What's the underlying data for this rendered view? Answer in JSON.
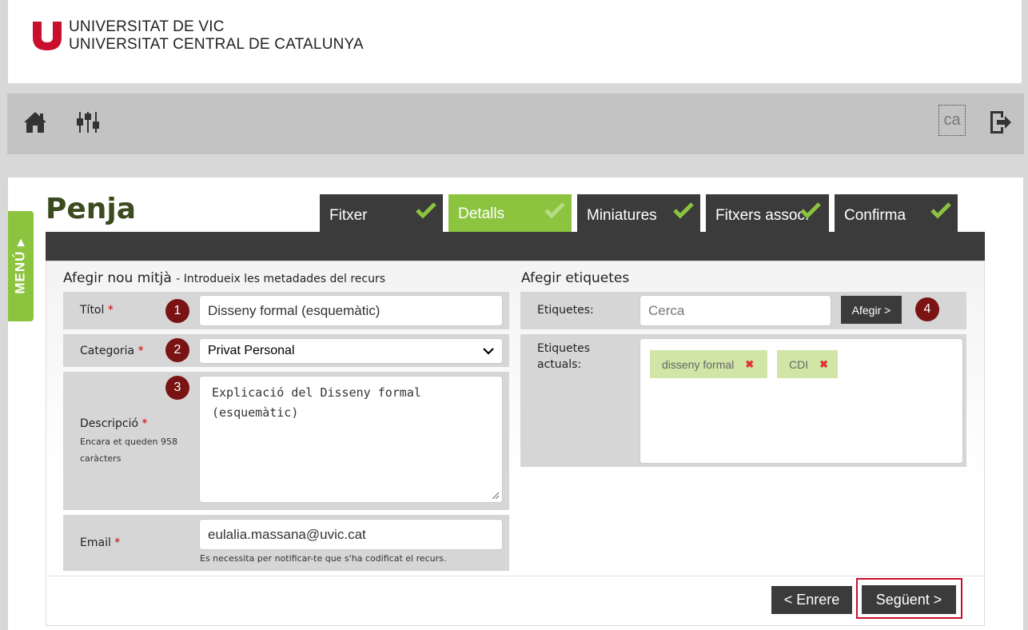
{
  "header": {
    "university_line1": "UNIVERSITAT DE VIC",
    "university_line2": "UNIVERSITAT CENTRAL DE CATALUNYA",
    "brand_color": "#c8102e"
  },
  "toolbar": {
    "icons": [
      "home-icon",
      "settings-sliders-icon",
      "logout-icon"
    ],
    "language": "ca"
  },
  "side_menu": {
    "label": "MENÚ ▸"
  },
  "page": {
    "title": "Penja"
  },
  "tabs": [
    {
      "label": "Fitxer",
      "active": false,
      "done": true
    },
    {
      "label": "Detalls",
      "active": true,
      "done": true
    },
    {
      "label": "Miniatures",
      "active": false,
      "done": true
    },
    {
      "label": "Fitxers assoc.",
      "active": false,
      "done": true
    },
    {
      "label": "Confirma",
      "active": false,
      "done": true
    }
  ],
  "form": {
    "heading": "Afegir nou mitjà",
    "subheading": "- Introdueix les metadades del recurs",
    "title_label": "Títol",
    "title_value": "Disseny formal (esquemàtic)",
    "category_label": "Categoria",
    "category_value": "Privat Personal",
    "description_label": "Descripció",
    "description_hint": "Encara et queden 958 caràcters",
    "description_value": "Explicació del Disseny formal (esquemàtic)",
    "email_label": "Email",
    "email_value": "eulalia.massana@uvic.cat",
    "email_hint": "Es necessita per notificar-te que s'ha codificat el recurs.",
    "required_mark": "*"
  },
  "tags": {
    "heading": "Afegir etiquetes",
    "label": "Etiquetes:",
    "search_placeholder": "Cerca",
    "add_button": "Afegir >",
    "current_label_line1": "Etiquetes",
    "current_label_line2": "actuals:",
    "current": [
      "disseny formal",
      "CDI"
    ],
    "remove_symbol": "✖"
  },
  "steps": [
    "1",
    "2",
    "3",
    "4"
  ],
  "navigation": {
    "back": "< Enrere",
    "next": "Següent >"
  },
  "colors": {
    "accent_green": "#8cc43f",
    "dark": "#3b3b3b",
    "step_badge": "#7a1414",
    "highlight_border": "#c8102e"
  }
}
